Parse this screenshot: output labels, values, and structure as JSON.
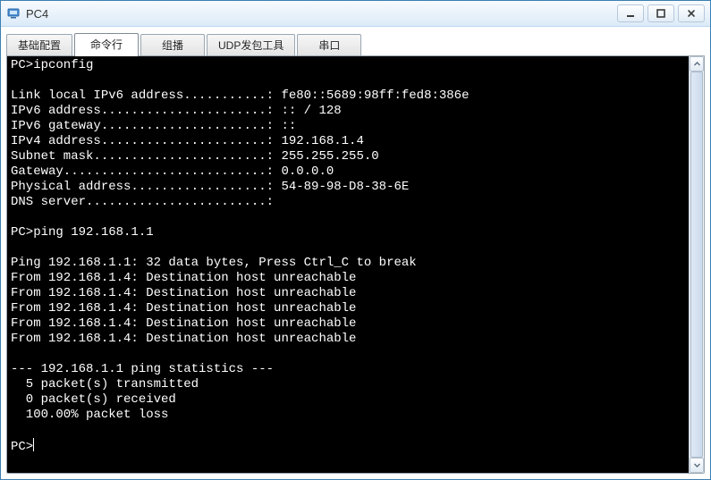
{
  "window": {
    "title": "PC4"
  },
  "tabs": [
    {
      "label": "基础配置",
      "active": false
    },
    {
      "label": "命令行",
      "active": true
    },
    {
      "label": "组播",
      "active": false
    },
    {
      "label": "UDP发包工具",
      "active": false
    },
    {
      "label": "串口",
      "active": false
    }
  ],
  "terminal": {
    "prompt": "PC>",
    "commands": [
      {
        "cmd": "ipconfig"
      },
      {
        "cmd": "ping 192.168.1.1"
      }
    ],
    "ipconfig": {
      "link_local_ipv6_address": "fe80::5689:98ff:fed8:386e",
      "ipv6_address": ":: / 128",
      "ipv6_gateway": "::",
      "ipv4_address": "192.168.1.4",
      "subnet_mask": "255.255.255.0",
      "gateway": "0.0.0.0",
      "physical_address": "54-89-98-D8-38-6E",
      "dns_server": ""
    },
    "ping": {
      "target": "192.168.1.1",
      "data_bytes": 32,
      "break_hint": "Press Ctrl_C to break",
      "replies": [
        {
          "from": "192.168.1.4",
          "msg": "Destination host unreachable"
        },
        {
          "from": "192.168.1.4",
          "msg": "Destination host unreachable"
        },
        {
          "from": "192.168.1.4",
          "msg": "Destination host unreachable"
        },
        {
          "from": "192.168.1.4",
          "msg": "Destination host unreachable"
        },
        {
          "from": "192.168.1.4",
          "msg": "Destination host unreachable"
        }
      ],
      "stats": {
        "transmitted": 5,
        "received": 0,
        "loss_percent": "100.00%"
      }
    },
    "lines": [
      "PC>ipconfig",
      "",
      "Link local IPv6 address...........: fe80::5689:98ff:fed8:386e",
      "IPv6 address......................: :: / 128",
      "IPv6 gateway......................: ::",
      "IPv4 address......................: 192.168.1.4",
      "Subnet mask.......................: 255.255.255.0",
      "Gateway...........................: 0.0.0.0",
      "Physical address..................: 54-89-98-D8-38-6E",
      "DNS server........................:",
      "",
      "PC>ping 192.168.1.1",
      "",
      "Ping 192.168.1.1: 32 data bytes, Press Ctrl_C to break",
      "From 192.168.1.4: Destination host unreachable",
      "From 192.168.1.4: Destination host unreachable",
      "From 192.168.1.4: Destination host unreachable",
      "From 192.168.1.4: Destination host unreachable",
      "From 192.168.1.4: Destination host unreachable",
      "",
      "--- 192.168.1.1 ping statistics ---",
      "  5 packet(s) transmitted",
      "  0 packet(s) received",
      "  100.00% packet loss",
      "",
      "PC>"
    ]
  }
}
